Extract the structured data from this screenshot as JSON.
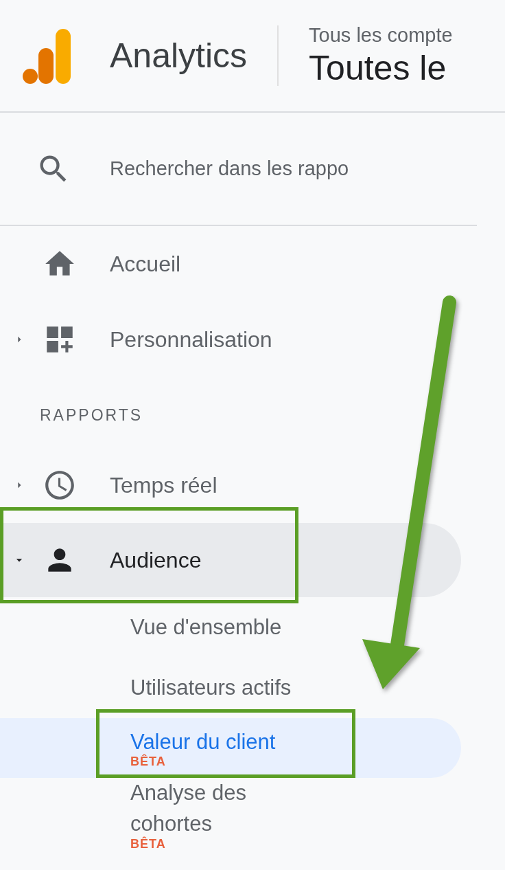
{
  "header": {
    "product": "Analytics",
    "account_path": "Tous les compte",
    "view_name": "Toutes le"
  },
  "search": {
    "placeholder": "Rechercher dans les rappo"
  },
  "nav": [
    {
      "kind": "item",
      "label": "Accueil",
      "expandable": false,
      "expanded": false,
      "highlighted": false,
      "annotated": false
    },
    {
      "kind": "item",
      "label": "Personnalisation",
      "expandable": true,
      "expanded": false,
      "highlighted": false,
      "annotated": false
    },
    {
      "kind": "section",
      "label": "RAPPORTS"
    },
    {
      "kind": "item",
      "label": "Temps réel",
      "expandable": true,
      "expanded": false,
      "highlighted": false,
      "annotated": false
    },
    {
      "kind": "item",
      "label": "Audience",
      "expandable": true,
      "expanded": true,
      "highlighted": true,
      "annotated": true,
      "children": [
        {
          "label": "Vue d'ensemble",
          "selected": false,
          "annotated": false
        },
        {
          "label": "Utilisateurs actifs",
          "selected": false,
          "annotated": false
        },
        {
          "label": "Valeur du client",
          "selected": true,
          "badge": "BÊTA",
          "annotated": true
        },
        {
          "label": "Analyse des cohortes",
          "selected": false,
          "badge": "BÊTA",
          "annotated": false
        }
      ]
    }
  ]
}
